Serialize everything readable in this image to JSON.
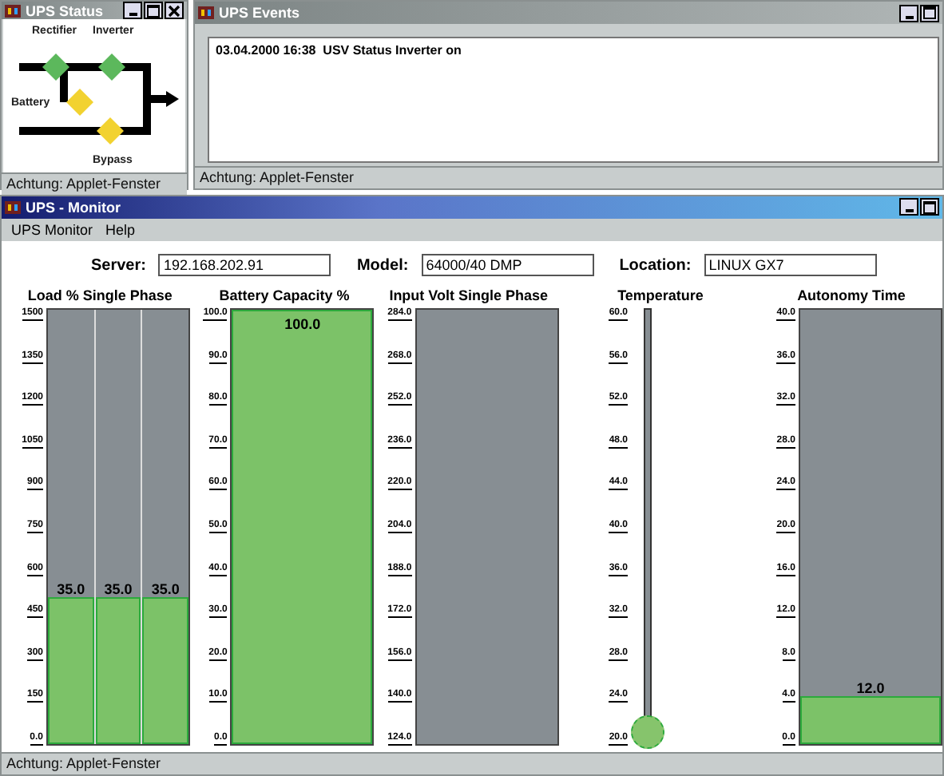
{
  "status_window": {
    "title": "UPS Status",
    "active": false,
    "components": [
      {
        "name": "Rectifier",
        "color": "#5cb85c"
      },
      {
        "name": "Inverter",
        "color": "#5cb85c"
      },
      {
        "name": "Battery",
        "color": "#f2d230"
      },
      {
        "name": "Bypass",
        "color": "#f2d230"
      }
    ],
    "status_bar": "Achtung: Applet-Fenster"
  },
  "events_window": {
    "title": "UPS Events",
    "active": false,
    "events": [
      "03.04.2000 16:38  USV Status Inverter on"
    ],
    "status_bar": "Achtung: Applet-Fenster"
  },
  "monitor_window": {
    "title": "UPS - Monitor",
    "active": true,
    "menu": [
      "UPS Monitor",
      "Help"
    ],
    "fields": [
      {
        "label": "Server:",
        "value": "192.168.202.91"
      },
      {
        "label": "Model:",
        "value": "64000/40 DMP"
      },
      {
        "label": "Location:",
        "value": "LINUX GX7"
      }
    ],
    "gauges": [
      {
        "kind": "split",
        "title": "Load % Single Phase",
        "ticks": [
          "1500",
          "1350",
          "1200",
          "1050",
          "900",
          "750",
          "600",
          "450",
          "300",
          "150",
          "0.0"
        ],
        "phases": [
          {
            "reading": "35.0",
            "level": 0.34
          },
          {
            "reading": "35.0",
            "level": 0.34
          },
          {
            "reading": "35.0",
            "level": 0.34
          }
        ]
      },
      {
        "kind": "bar",
        "title": "Battery Capacity %",
        "ticks": [
          "100.0",
          "90.0",
          "80.0",
          "70.0",
          "60.0",
          "50.0",
          "40.0",
          "30.0",
          "20.0",
          "10.0",
          "0.0"
        ],
        "level": 1,
        "reading": "100.0"
      },
      {
        "kind": "bar",
        "title": "Input Volt Single Phase",
        "ticks": [
          "284.0",
          "268.0",
          "252.0",
          "236.0",
          "220.0",
          "204.0",
          "188.0",
          "172.0",
          "156.0",
          "140.0",
          "124.0"
        ]
      },
      {
        "kind": "thermometer",
        "title": "Temperature",
        "ticks": [
          "60.0",
          "56.0",
          "52.0",
          "48.0",
          "44.0",
          "40.0",
          "36.0",
          "32.0",
          "28.0",
          "24.0",
          "20.0"
        ]
      },
      {
        "kind": "bar",
        "title": "Autonomy Time",
        "ticks": [
          "40.0",
          "36.0",
          "32.0",
          "28.0",
          "24.0",
          "20.0",
          "16.0",
          "12.0",
          "8.0",
          "4.0",
          "0.0"
        ],
        "level": 0.11,
        "reading": "12.0"
      }
    ],
    "status_bar": "Achtung: Applet-Fenster"
  }
}
